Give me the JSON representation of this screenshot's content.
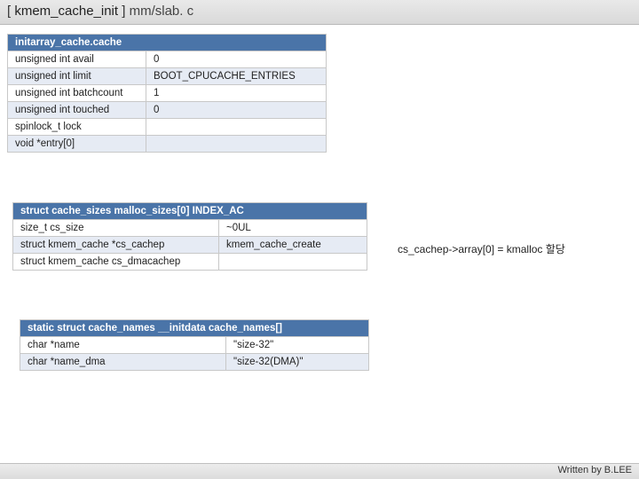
{
  "title": {
    "lb": "[",
    "fn": " kmem_cache_init ",
    "rb": "]",
    "path": "  mm/slab. c"
  },
  "table1": {
    "header": "initarray_cache.cache",
    "rows": [
      {
        "k": "unsigned int avail",
        "v": "0"
      },
      {
        "k": "unsigned int limit",
        "v": "BOOT_CPUCACHE_ENTRIES"
      },
      {
        "k": "unsigned int batchcount",
        "v": "1"
      },
      {
        "k": "unsigned int touched",
        "v": "0"
      },
      {
        "k": "spinlock_t lock",
        "v": ""
      },
      {
        "k": "void *entry[0]",
        "v": ""
      }
    ]
  },
  "table2": {
    "header": "struct cache_sizes malloc_sizes[0] INDEX_AC",
    "rows": [
      {
        "k": "size_t  cs_size",
        "v": "~0UL"
      },
      {
        "k": "struct kmem_cache  *cs_cachep",
        "v": "kmem_cache_create"
      },
      {
        "k": "struct kmem_cache  cs_dmacachep",
        "v": ""
      }
    ]
  },
  "table3": {
    "header": "static struct cache_names __initdata cache_names[]",
    "rows": [
      {
        "k": "char *name",
        "v": "\"size-32\""
      },
      {
        "k": "char *name_dma",
        "v": "\"size-32(DMA)\""
      }
    ]
  },
  "annotation": "cs_cachep->array[0] =   kmalloc 할당",
  "footer": "Written by B.LEE"
}
